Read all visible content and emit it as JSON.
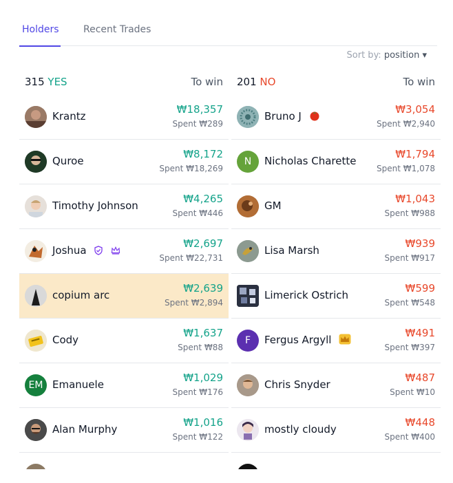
{
  "tabs": {
    "holders": "Holders",
    "recent_trades": "Recent Trades"
  },
  "sort": {
    "label": "Sort by:",
    "value": "position ▾"
  },
  "yes_column": {
    "count": "315",
    "side": "YES",
    "to_win_label": "To win",
    "rows": [
      {
        "name": "Krantz",
        "win": "₩18,357",
        "spent": "Spent ₩289"
      },
      {
        "name": "Quroe",
        "win": "₩8,172",
        "spent": "Spent ₩18,269"
      },
      {
        "name": "Timothy Johnson",
        "win": "₩4,265",
        "spent": "Spent ₩446"
      },
      {
        "name": "Joshua",
        "win": "₩2,697",
        "spent": "Spent ₩22,731"
      },
      {
        "name": "copium arc",
        "win": "₩2,639",
        "spent": "Spent ₩2,894"
      },
      {
        "name": "Cody",
        "win": "₩1,637",
        "spent": "Spent ₩88"
      },
      {
        "name": "Emanuele",
        "initials": "EM",
        "win": "₩1,029",
        "spent": "Spent ₩176"
      },
      {
        "name": "Alan Murphy",
        "win": "₩1,016",
        "spent": "Spent ₩122"
      }
    ]
  },
  "no_column": {
    "count": "201",
    "side": "NO",
    "to_win_label": "To win",
    "rows": [
      {
        "name": "Bruno J",
        "win": "₩3,054",
        "spent": "Spent ₩2,940"
      },
      {
        "name": "Nicholas Charette",
        "initials": "N",
        "win": "₩1,794",
        "spent": "Spent ₩1,078"
      },
      {
        "name": "GM",
        "win": "₩1,043",
        "spent": "Spent ₩988"
      },
      {
        "name": "Lisa Marsh",
        "win": "₩939",
        "spent": "Spent ₩917"
      },
      {
        "name": "Limerick Ostrich",
        "win": "₩599",
        "spent": "Spent ₩548"
      },
      {
        "name": "Fergus Argyll",
        "initials": "F",
        "win": "₩491",
        "spent": "Spent ₩397"
      },
      {
        "name": "Chris Snyder",
        "win": "₩487",
        "spent": "Spent ₩10"
      },
      {
        "name": "mostly cloudy",
        "win": "₩448",
        "spent": "Spent ₩400"
      }
    ]
  },
  "colors": {
    "yes": "#14a38a",
    "no": "#e8482b",
    "accent": "#4f46e5",
    "highlight_row": "#fbe9c8"
  }
}
